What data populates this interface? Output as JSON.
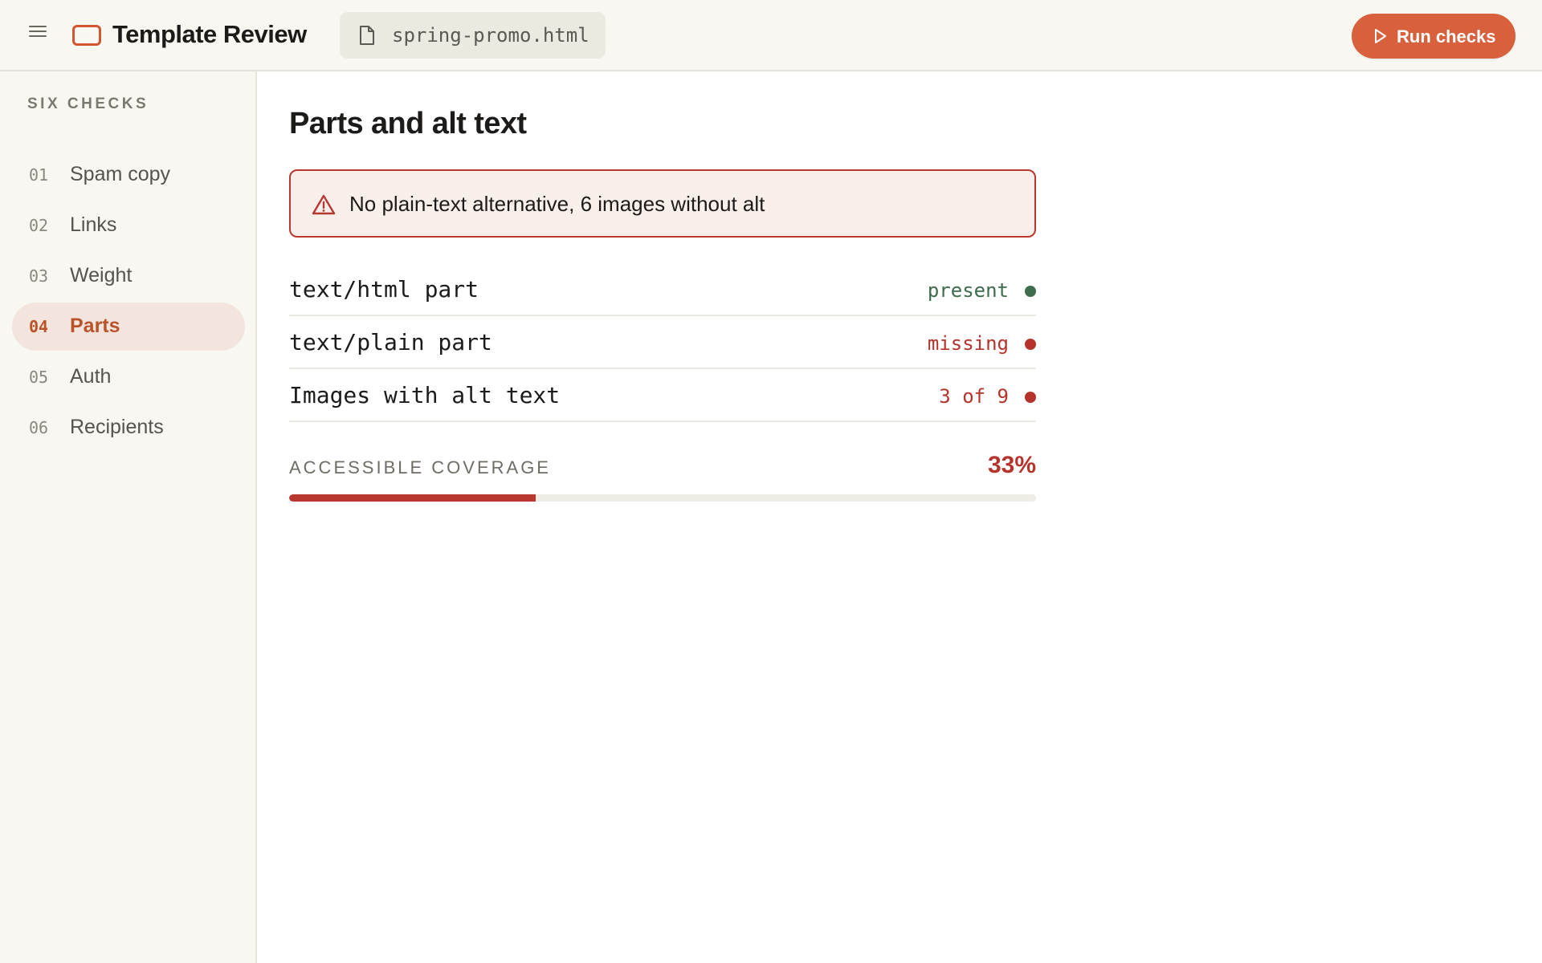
{
  "app": {
    "title": "Template Review",
    "menu_icon": "hamburger-menu-icon",
    "logo_icon": "email-frame-icon",
    "accent_color": "#d9603c"
  },
  "file": {
    "name": "spring-promo.html",
    "icon": "document-icon"
  },
  "toolbar": {
    "run_label": "Run checks",
    "run_icon": "play-icon"
  },
  "sidebar": {
    "heading": "SIX CHECKS",
    "items": [
      {
        "num": "01",
        "label": "Spam copy",
        "active": false
      },
      {
        "num": "02",
        "label": "Links",
        "active": false
      },
      {
        "num": "03",
        "label": "Weight",
        "active": false
      },
      {
        "num": "04",
        "label": "Parts",
        "active": true
      },
      {
        "num": "05",
        "label": "Auth",
        "active": false
      },
      {
        "num": "06",
        "label": "Recipients",
        "active": false
      }
    ]
  },
  "main": {
    "title": "Parts and alt text",
    "alert": {
      "icon": "warning-triangle-icon",
      "text": "No plain-text alternative, 6 images without alt",
      "color": "#b8372f"
    },
    "checks": [
      {
        "name": "text/html part",
        "status": "present",
        "state": "ok",
        "color": "#3d6b4c"
      },
      {
        "name": "text/plain part",
        "status": "missing",
        "state": "fail",
        "color": "#b5332b"
      },
      {
        "name": "Images with alt text",
        "status": "3 of 9",
        "state": "fail",
        "color": "#b5332b"
      }
    ],
    "coverage": {
      "label": "ACCESSIBLE COVERAGE",
      "value_text": "33%",
      "fraction": 0.33,
      "color": "#b8372f"
    }
  }
}
